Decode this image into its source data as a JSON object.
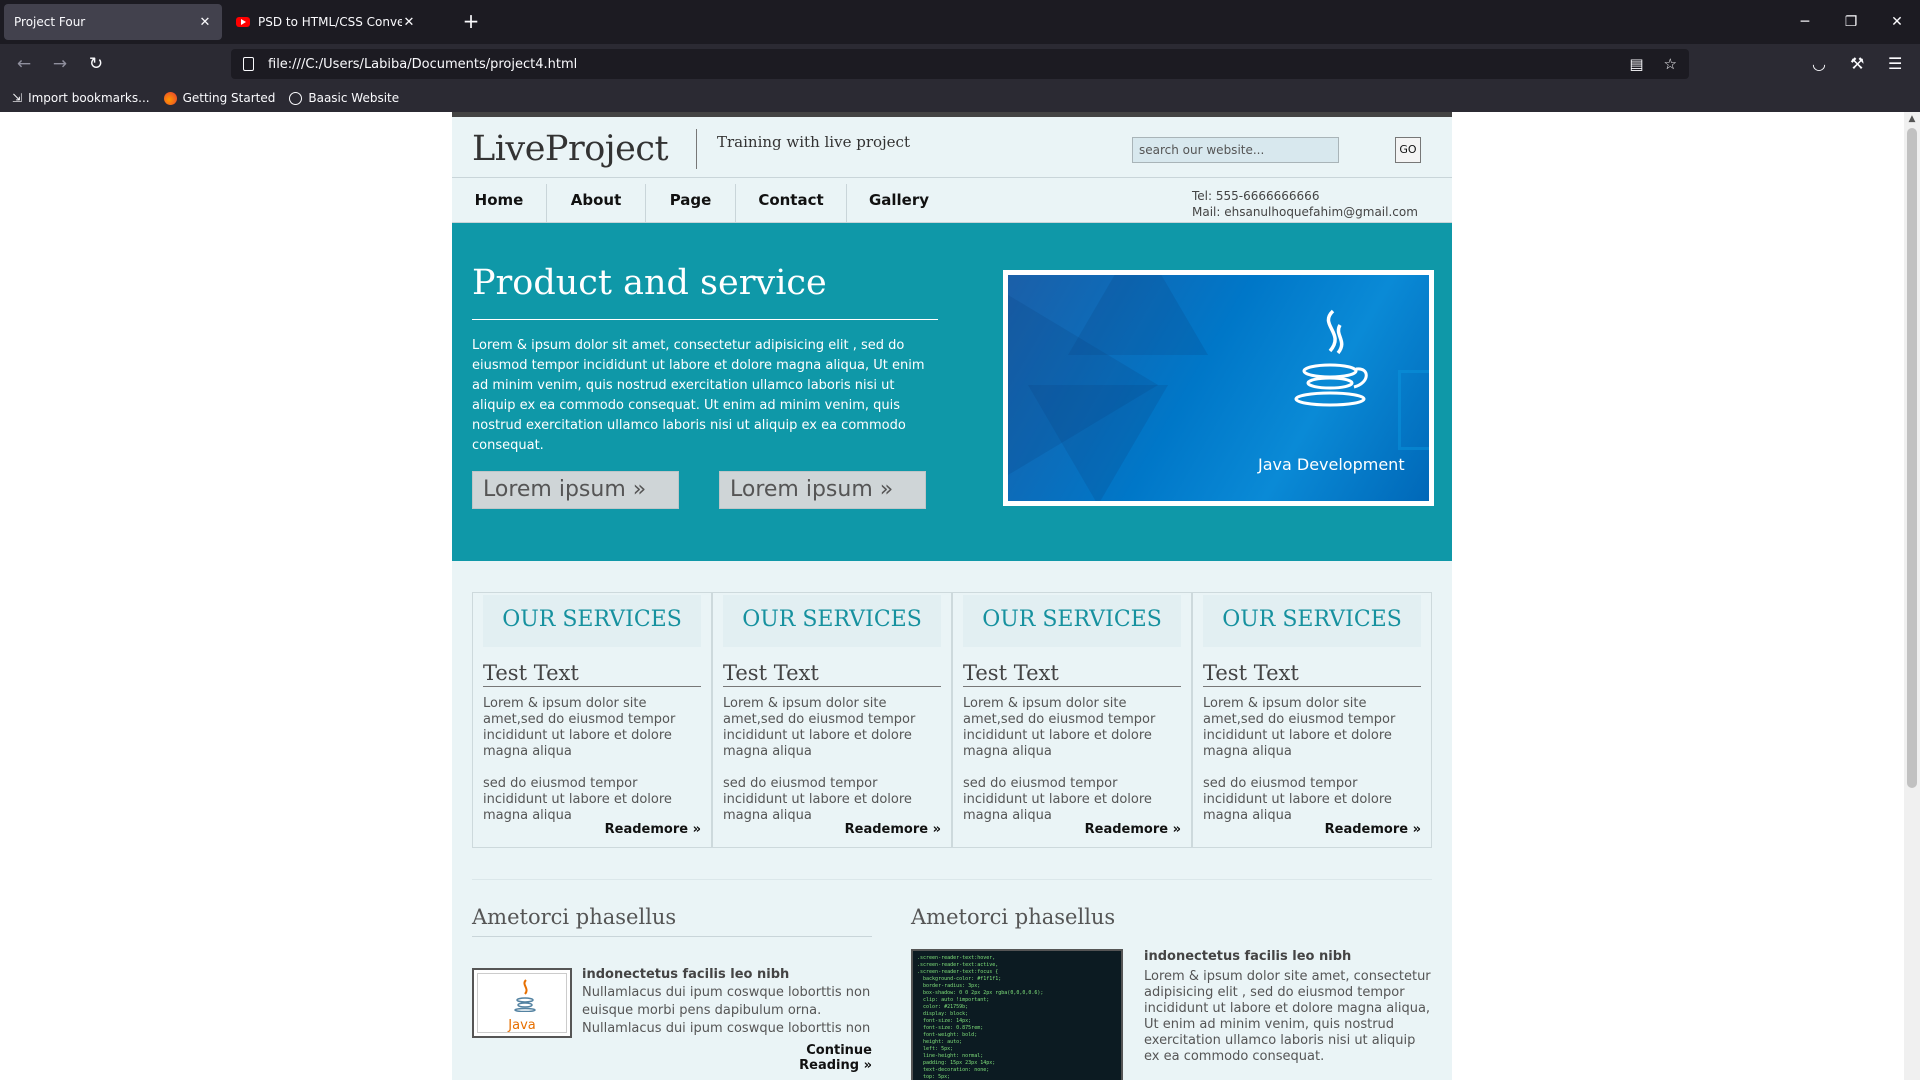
{
  "browser": {
    "tabs": [
      {
        "title": "Project Four",
        "active": true
      },
      {
        "title": "PSD to HTML/CSS Conversion (",
        "active": false
      }
    ],
    "url": "file:///C:/Users/Labiba/Documents/project4.html",
    "bookmarks": [
      {
        "label": "Import bookmarks...",
        "icon": "import-icon"
      },
      {
        "label": "Getting Started",
        "icon": "firefox-icon"
      },
      {
        "label": "Baasic Website",
        "icon": "globe-icon"
      }
    ]
  },
  "site": {
    "logo": "LiveProject",
    "tagline": "Training with live project",
    "search_placeholder": "search our website...",
    "search_button": "GO",
    "nav": [
      "Home",
      "About",
      "Page",
      "Contact",
      "Gallery"
    ],
    "contact": {
      "tel": "Tel: 555-6666666666",
      "mail": "Mail: ehsanulhoquefahim@gmail.com"
    },
    "hero": {
      "title": "Product and service",
      "text": "Lorem & ipsum dolor sit amet, consectetur adipisicing elit , sed do eiusmod tempor incididunt ut labore et dolore magna aliqua, Ut enim ad minim venim, quis nostrud exercitation ullamco laboris nisi ut aliquip ex ea commodo consequat. Ut enim ad minim venim, quis nostrud exercitation ullamco laboris nisi ut aliquip ex ea commodo consequat.",
      "buttons": [
        "Lorem ipsum »",
        "Lorem ipsum »"
      ],
      "image_caption": "Java Development"
    },
    "services": [
      {
        "heading": "OUR SERVICES",
        "title": "Test Text",
        "text1": "Lorem & ipsum dolor site amet,sed do eiusmod tempor incididunt ut labore et dolore magna aliqua",
        "text2": "sed do eiusmod tempor incididunt ut labore et dolore magna aliqua",
        "link": "Reademore »"
      },
      {
        "heading": "OUR SERVICES",
        "title": "Test Text",
        "text1": "Lorem & ipsum dolor site amet,sed do eiusmod tempor incididunt ut labore et dolore magna aliqua",
        "text2": "sed do eiusmod tempor incididunt ut labore et dolore magna aliqua",
        "link": "Reademore »"
      },
      {
        "heading": "OUR SERVICES",
        "title": "Test Text",
        "text1": "Lorem & ipsum dolor site amet,sed do eiusmod tempor incididunt ut labore et dolore magna aliqua",
        "text2": "sed do eiusmod tempor incididunt ut labore et dolore magna aliqua",
        "link": "Reademore »"
      },
      {
        "heading": "OUR SERVICES",
        "title": "Test Text",
        "text1": "Lorem & ipsum dolor site amet,sed do eiusmod tempor incididunt ut labore et dolore magna aliqua",
        "text2": "sed do eiusmod tempor incididunt ut labore et dolore magna aliqua",
        "link": "Reademore »"
      }
    ],
    "left_section": {
      "heading": "Ametorci phasellus",
      "item_title": "indonectetus facilis leo nibh",
      "item_text": "Nullamlacus dui ipum coswque loborttis non euisque morbi pens dapibulum orna. Nullamlacus dui ipum coswque loborttis non",
      "link": "Continue Reading »",
      "thumb_label": "Java"
    },
    "right_section": {
      "heading": "Ametorci phasellus",
      "item_title": "indonectetus facilis leo nibh",
      "item_text": "Lorem & ipsum dolor site amet, consectetur adipisicing elit , sed do eiusmod tempor incididunt ut labore et dolore magna aliqua, Ut enim ad minim venim, quis nostrud exercitation ullamco laboris nisi ut aliquip ex ea commodo consequat."
    },
    "colors": {
      "accent": "#0f98a8",
      "background": "#eaf4f6",
      "heading_teal": "#16919f"
    }
  }
}
